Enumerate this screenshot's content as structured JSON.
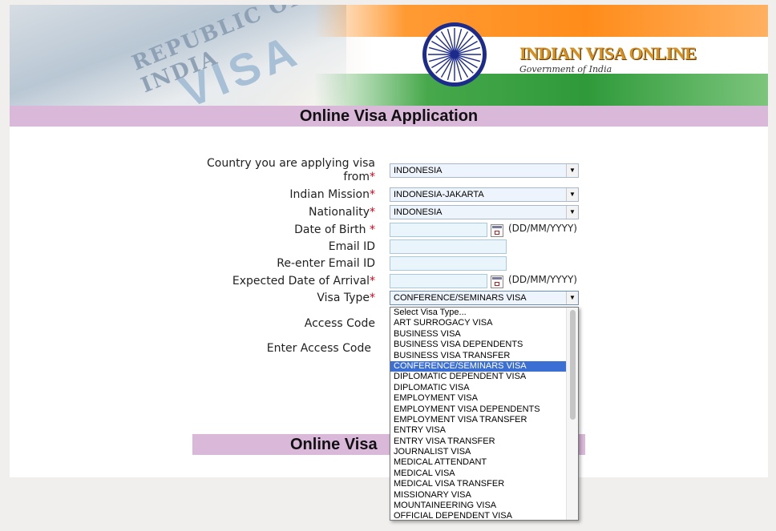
{
  "banner": {
    "stamp_text": "REPUBLIC OF INDIA",
    "visa_text": "VISA",
    "logo_line1": "INDIAN VISA ONLINE",
    "logo_line2": "Government of India"
  },
  "title": "Online Visa Application",
  "title_bottom": "Online Visa",
  "form": {
    "country_label": "Country you are applying visa",
    "country_label_2": "from",
    "country_value": "INDONESIA",
    "mission_label": "Indian Mission",
    "mission_value": "INDONESIA-JAKARTA",
    "nationality_label": "Nationality",
    "nationality_value": "INDONESIA",
    "dob_label": "Date of Birth",
    "dob_hint": "(DD/MM/YYYY)",
    "email_label": "Email ID",
    "reemail_label": "Re-enter Email ID",
    "arrival_label": "Expected Date of Arrival",
    "arrival_hint": "(DD/MM/YYYY)",
    "visatype_label": "Visa Type",
    "visatype_value": "CONFERENCE/SEMINARS VISA",
    "access_code_label": "Access Code",
    "enter_access_code_label": "Enter Access Code",
    "required_mark": "*"
  },
  "visa_options": [
    "Select Visa Type...",
    "ART SURROGACY VISA",
    "BUSINESS VISA",
    "BUSINESS VISA DEPENDENTS",
    "BUSINESS VISA TRANSFER",
    "CONFERENCE/SEMINARS VISA",
    "DIPLOMATIC DEPENDENT VISA",
    "DIPLOMATIC VISA",
    "EMPLOYMENT VISA",
    "EMPLOYMENT VISA DEPENDENTS",
    "EMPLOYMENT VISA TRANSFER",
    "ENTRY VISA",
    "ENTRY VISA TRANSFER",
    "JOURNALIST VISA",
    "MEDICAL ATTENDANT",
    "MEDICAL VISA",
    "MEDICAL VISA TRANSFER",
    "MISSIONARY VISA",
    "MOUNTAINEERING VISA",
    "OFFICIAL DEPENDENT VISA"
  ],
  "selected_option_index": 5,
  "colors": {
    "title_bar": "#d9b8d9",
    "required": "#e0001a",
    "selected_option": "#3b6fd4",
    "chakra": "#1c2b8c"
  }
}
